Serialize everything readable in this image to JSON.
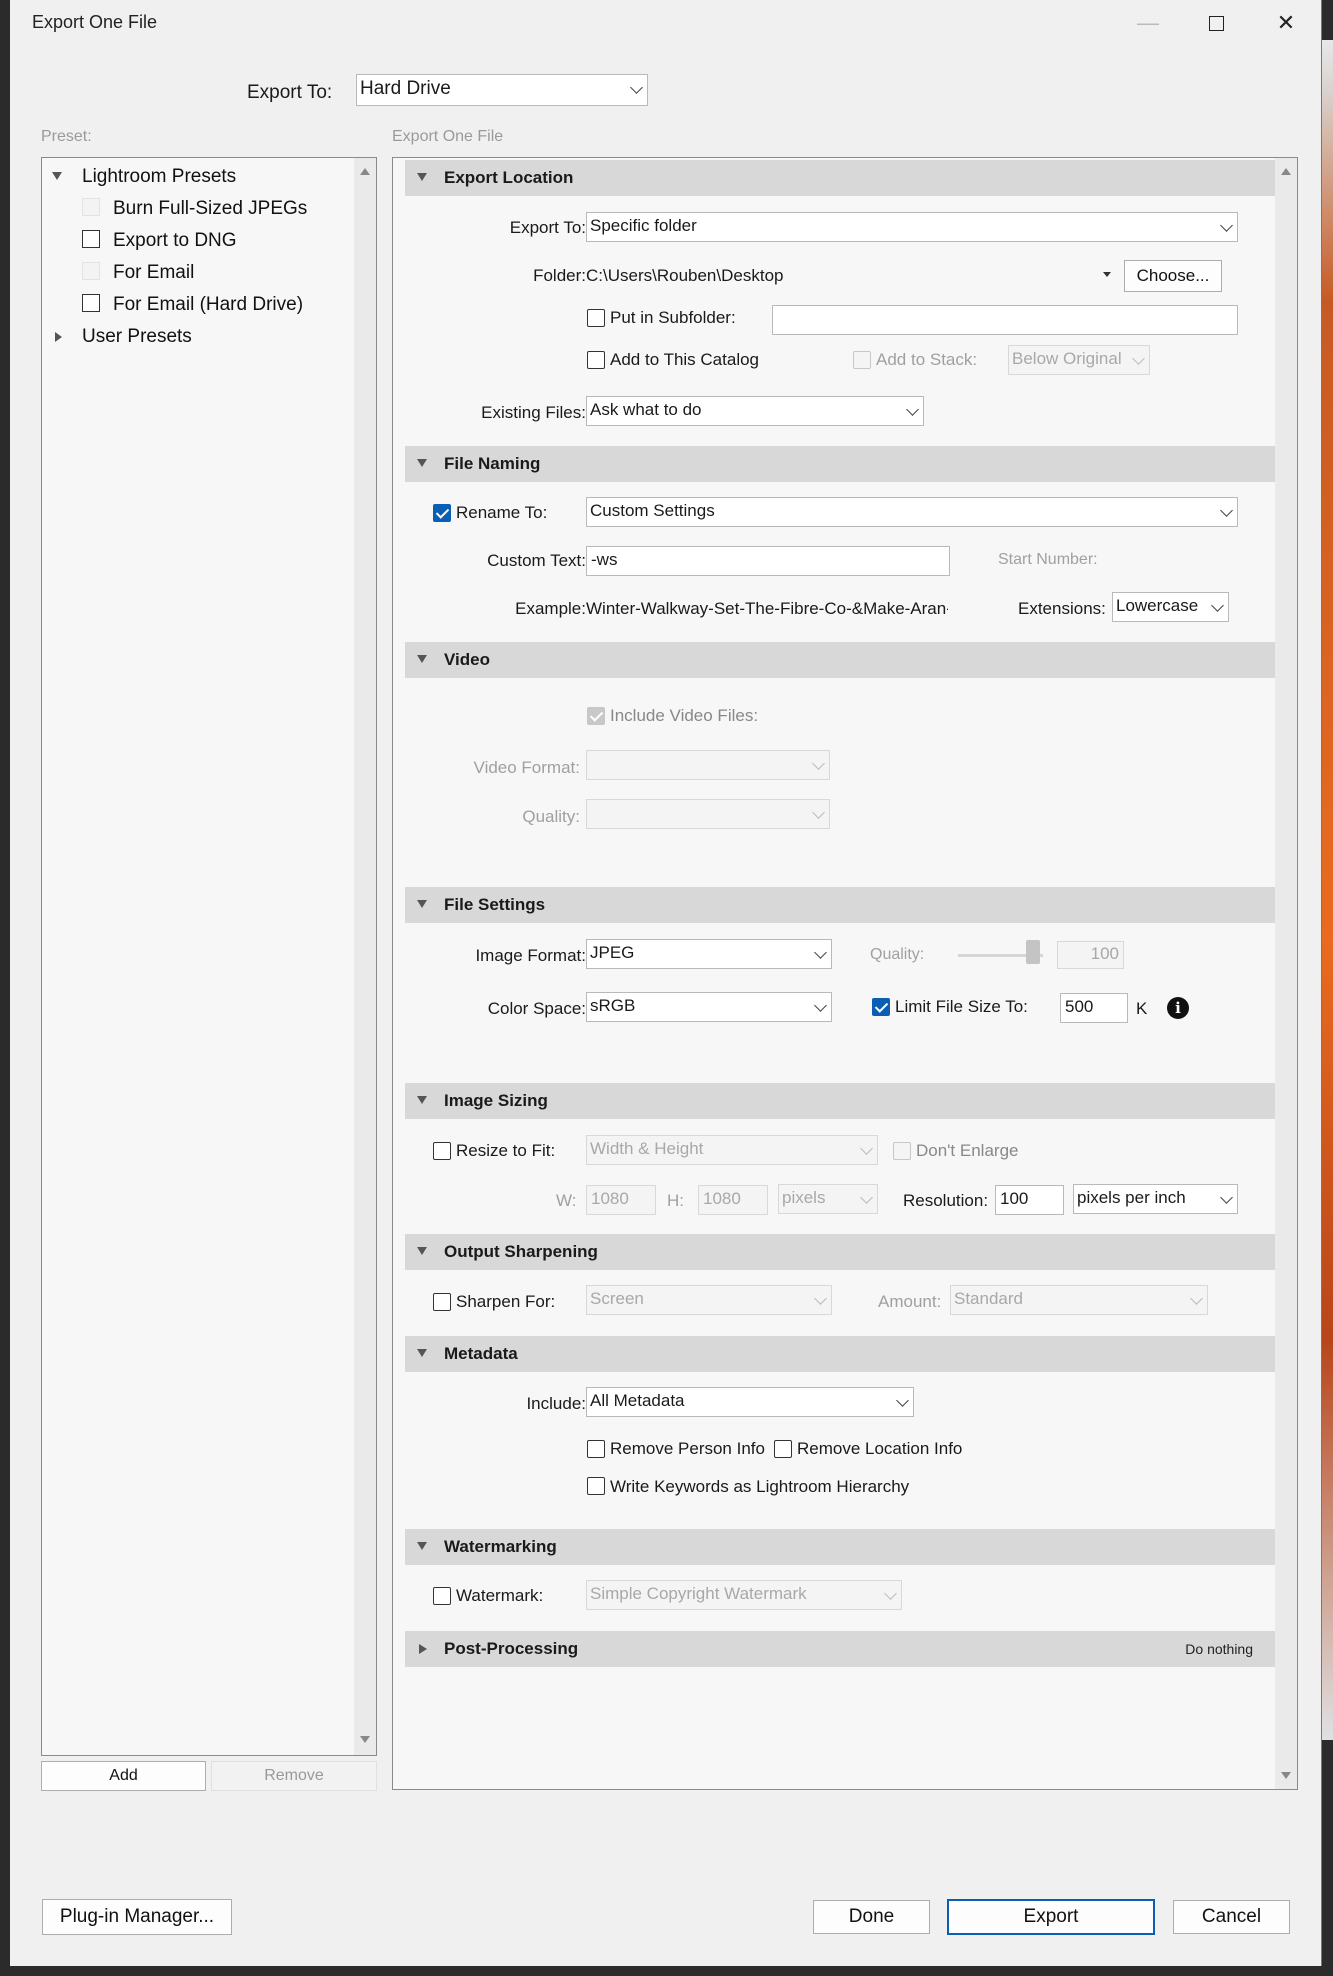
{
  "window": {
    "title": "Export One File"
  },
  "export_to": {
    "label": "Export To:",
    "value": "Hard Drive"
  },
  "preset": {
    "label": "Preset:",
    "groups": [
      {
        "name": "Lightroom Presets",
        "items": [
          "Burn Full-Sized JPEGs",
          "Export to DNG",
          "For Email",
          "For Email (Hard Drive)"
        ]
      },
      {
        "name": "User Presets"
      }
    ],
    "add_label": "Add",
    "remove_label": "Remove"
  },
  "settings_title": "Export One File",
  "export_location": {
    "title": "Export Location",
    "export_to_label": "Export To:",
    "export_to_value": "Specific folder",
    "folder_label": "Folder:",
    "folder_value": "C:\\Users\\Rouben\\Desktop",
    "choose_label": "Choose...",
    "subfolder_label": "Put in Subfolder:",
    "subfolder_value": "",
    "add_catalog_label": "Add to This Catalog",
    "add_stack_label": "Add to Stack:",
    "add_stack_value": "Below Original",
    "existing_files_label": "Existing Files:",
    "existing_files_value": "Ask what to do"
  },
  "file_naming": {
    "title": "File Naming",
    "rename_label": "Rename To:",
    "rename_value": "Custom Settings",
    "custom_text_label": "Custom Text:",
    "custom_text_value": "-ws",
    "start_number_label": "Start Number:",
    "example_label": "Example:",
    "example_value": "Winter-Walkway-Set-The-Fibre-Co-&Make-Aran-G",
    "extensions_label": "Extensions:",
    "extensions_value": "Lowercase"
  },
  "video": {
    "title": "Video",
    "include_label": "Include Video Files:",
    "format_label": "Video Format:",
    "quality_label": "Quality:"
  },
  "file_settings": {
    "title": "File Settings",
    "format_label": "Image Format:",
    "format_value": "JPEG",
    "quality_label": "Quality:",
    "quality_value": "100",
    "quality_level": 1.0,
    "color_space_label": "Color Space:",
    "color_space_value": "sRGB",
    "limit_label": "Limit File Size To:",
    "limit_value": "500",
    "limit_unit": "K"
  },
  "image_sizing": {
    "title": "Image Sizing",
    "resize_label": "Resize to Fit:",
    "resize_value": "Width & Height",
    "dont_enlarge_label": "Don't Enlarge",
    "w_label": "W:",
    "w_value": "1080",
    "h_label": "H:",
    "h_value": "1080",
    "unit_value": "pixels",
    "resolution_label": "Resolution:",
    "resolution_value": "100",
    "resolution_unit": "pixels per inch"
  },
  "output_sharpening": {
    "title": "Output Sharpening",
    "sharpen_label": "Sharpen For:",
    "sharpen_value": "Screen",
    "amount_label": "Amount:",
    "amount_value": "Standard"
  },
  "metadata": {
    "title": "Metadata",
    "include_label": "Include:",
    "include_value": "All Metadata",
    "remove_person_label": "Remove Person Info",
    "remove_location_label": "Remove Location Info",
    "keywords_label": "Write Keywords as Lightroom Hierarchy"
  },
  "watermarking": {
    "title": "Watermarking",
    "watermark_label": "Watermark:",
    "watermark_value": "Simple Copyright Watermark"
  },
  "post_processing": {
    "title": "Post-Processing",
    "value": "Do nothing"
  },
  "footer": {
    "plugin_label": "Plug-in Manager...",
    "done_label": "Done",
    "export_label": "Export",
    "cancel_label": "Cancel"
  },
  "colors": {
    "accent": "#0a5fb4",
    "section_header": "#d8d8d8",
    "window_bg": "#f0f0f0"
  }
}
